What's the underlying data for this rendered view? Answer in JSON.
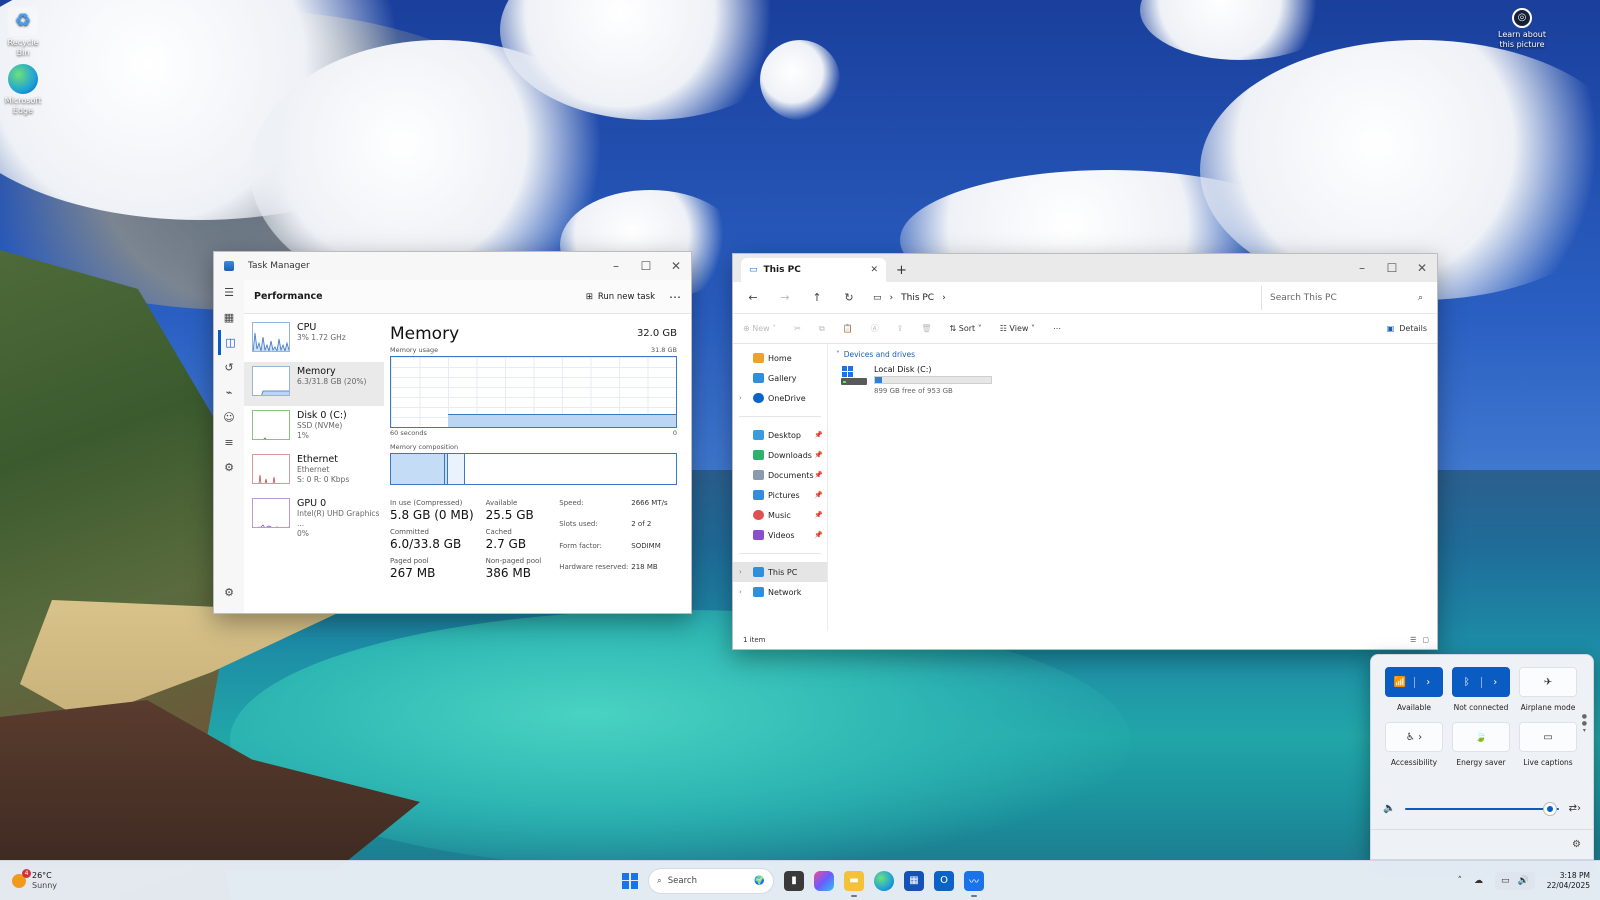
{
  "desktop": {
    "icons": [
      {
        "label": "Recycle Bin",
        "icon": "recycle-bin-icon"
      },
      {
        "label": "Microsoft Edge",
        "icon": "edge-icon"
      }
    ],
    "learn_label": "Learn about this picture"
  },
  "taskmanager": {
    "title": "Task Manager",
    "page_title": "Performance",
    "run_new_task": "Run new task",
    "perf_items": [
      {
        "name": "CPU",
        "sub1": "3% 1.72 GHz",
        "sub2": ""
      },
      {
        "name": "Memory",
        "sub1": "6.3/31.8 GB (20%)",
        "sub2": ""
      },
      {
        "name": "Disk 0 (C:)",
        "sub1": "SSD (NVMe)",
        "sub2": "1%"
      },
      {
        "name": "Ethernet",
        "sub1": "Ethernet",
        "sub2": "S: 0  R: 0 Kbps"
      },
      {
        "name": "GPU 0",
        "sub1": "Intel(R) UHD Graphics ...",
        "sub2": "0%"
      }
    ],
    "memory": {
      "title": "Memory",
      "total": "32.0 GB",
      "usage_label": "Memory usage",
      "usage_max": "31.8 GB",
      "axis_left": "60 seconds",
      "axis_right": "0",
      "composition_label": "Memory composition",
      "in_use_label": "In use (Compressed)",
      "in_use_value": "5.8 GB (0 MB)",
      "available_label": "Available",
      "available_value": "25.5 GB",
      "committed_label": "Committed",
      "committed_value": "6.0/33.8 GB",
      "cached_label": "Cached",
      "cached_value": "2.7 GB",
      "paged_label": "Paged pool",
      "paged_value": "267 MB",
      "nonpaged_label": "Non-paged pool",
      "nonpaged_value": "386 MB",
      "specs": [
        {
          "k": "Speed:",
          "v": "2666 MT/s"
        },
        {
          "k": "Slots used:",
          "v": "2 of 2"
        },
        {
          "k": "Form factor:",
          "v": "SODIMM"
        },
        {
          "k": "Hardware reserved:",
          "v": "218 MB"
        }
      ]
    }
  },
  "explorer": {
    "tab_title": "This PC",
    "address": "This PC",
    "search_placeholder": "Search This PC",
    "toolbar": {
      "new": "New",
      "sort": "Sort",
      "view": "View",
      "details": "Details"
    },
    "sidebar": [
      {
        "label": "Home",
        "pinned": false
      },
      {
        "label": "Gallery",
        "pinned": false
      },
      {
        "label": "OneDrive",
        "pinned": false
      },
      {
        "label": "Desktop",
        "pinned": true
      },
      {
        "label": "Downloads",
        "pinned": true
      },
      {
        "label": "Documents",
        "pinned": true
      },
      {
        "label": "Pictures",
        "pinned": true
      },
      {
        "label": "Music",
        "pinned": true
      },
      {
        "label": "Videos",
        "pinned": true
      },
      {
        "label": "This PC",
        "pinned": false
      },
      {
        "label": "Network",
        "pinned": false
      }
    ],
    "group_label": "Devices and drives",
    "drive": {
      "name": "Local Disk (C:)",
      "free_text": "899 GB free of 953 GB",
      "used_fraction": 0.057
    },
    "status": "1 item"
  },
  "quick_settings": {
    "tiles": [
      {
        "label": "Available",
        "on": true
      },
      {
        "label": "Not connected",
        "on": true
      },
      {
        "label": "Airplane mode",
        "on": false
      },
      {
        "label": "Accessibility",
        "on": false
      },
      {
        "label": "Energy saver",
        "on": false
      },
      {
        "label": "Live captions",
        "on": false
      }
    ],
    "volume_fraction": 0.98
  },
  "taskbar": {
    "temp": "26°C",
    "condition": "Sunny",
    "weather_badge": "4",
    "search_label": "Search",
    "time": "3:18 PM",
    "date": "22/04/2025"
  },
  "colors": {
    "accent": "#0a5cc2",
    "graph_line": "#3b78c4",
    "graph_fill": "#bcd5f3"
  }
}
